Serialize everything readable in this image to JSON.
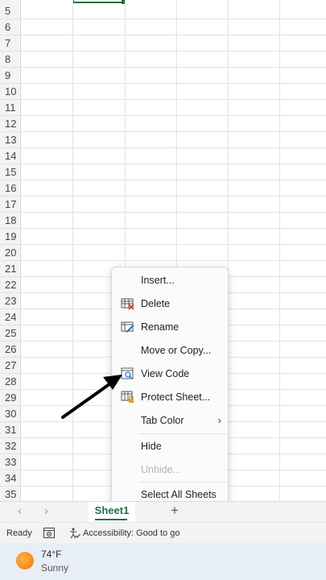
{
  "grid": {
    "row_numbers": [
      "5",
      "6",
      "7",
      "8",
      "9",
      "10",
      "11",
      "12",
      "13",
      "14",
      "15",
      "16",
      "17",
      "18",
      "19",
      "20",
      "21",
      "22",
      "23",
      "24",
      "25",
      "26",
      "27",
      "28",
      "29",
      "30",
      "31",
      "32",
      "33",
      "34",
      "35"
    ]
  },
  "context_menu": {
    "items": [
      {
        "label": "Insert...",
        "icon": "",
        "enabled": true
      },
      {
        "label": "Delete",
        "icon": "delete-sheet-icon",
        "enabled": true
      },
      {
        "label": "Rename",
        "icon": "rename-sheet-icon",
        "enabled": true
      },
      {
        "label": "Move or Copy...",
        "icon": "",
        "enabled": true
      },
      {
        "label": "View Code",
        "icon": "view-code-icon",
        "enabled": true
      },
      {
        "label": "Protect Sheet...",
        "icon": "protect-sheet-icon",
        "enabled": true
      },
      {
        "label": "Tab Color",
        "icon": "",
        "enabled": true,
        "submenu": "›"
      },
      {
        "label": "Hide",
        "icon": "",
        "enabled": true
      },
      {
        "label": "Unhide...",
        "icon": "",
        "enabled": false
      },
      {
        "label": "Select All Sheets",
        "icon": "",
        "enabled": true
      }
    ]
  },
  "sheet_tabs": {
    "prev": "‹",
    "next": "›",
    "tabs": [
      "Sheet1"
    ],
    "add": "+"
  },
  "status_bar": {
    "ready": "Ready",
    "accessibility": "Accessibility: Good to go"
  },
  "weather": {
    "temp": "74°F",
    "condition": "Sunny"
  },
  "colors": {
    "accent": "#1e7145",
    "menu_bg": "#fbfbfb",
    "taskbar_bg": "#e8eef6"
  }
}
